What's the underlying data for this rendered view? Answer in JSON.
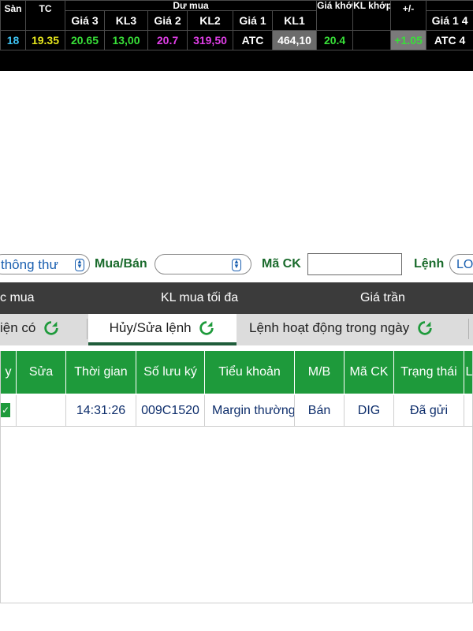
{
  "board": {
    "headers": {
      "san": "Sàn",
      "tc": "TC",
      "du_mua": "Dư mua",
      "gia_khop": "Giá khớp",
      "kl_khop": "KL khớp",
      "change": "+/-",
      "gia3": "Giá 3",
      "kl3": "KL3",
      "gia2": "Giá 2",
      "kl2": "KL2",
      "gia1": "Giá 1",
      "kl1": "KL1",
      "gia1_sell": "Giá 1"
    },
    "row": {
      "san": "18",
      "tc": "19.35",
      "gia3": "20.65",
      "kl3": "13,00",
      "gia2": "20.7",
      "kl2": "319,50",
      "gia1": "ATC",
      "kl1": "464,10",
      "gia_khop": "20.4",
      "kl_khop": "",
      "change": "+1.05",
      "gia1_sell": "ATC",
      "tail": "4"
    }
  },
  "filters": {
    "left_select_value": "thông thư",
    "mua_ban_label": "Mua/Bán",
    "mua_ban_value": "",
    "ma_ck_label": "Mã CK",
    "ma_ck_value": "",
    "lenh_label": "Lệnh",
    "lenh_value": "LO"
  },
  "info_bar": {
    "col1": "c mua",
    "col2": "KL mua tối đa",
    "col3": "Giá trần"
  },
  "tabs": [
    {
      "label": "iện có"
    },
    {
      "label": "Hủy/Sửa lệnh"
    },
    {
      "label": "Lệnh hoạt động trong ngày"
    }
  ],
  "orders": {
    "columns": [
      "y",
      "Sửa",
      "Thời gian",
      "Số lưu ký",
      "Tiểu khoản",
      "M/B",
      "Mã CK",
      "Trạng thái",
      "L"
    ],
    "rows": [
      {
        "time": "14:31:26",
        "depository": "009C1520",
        "sub_account": "Margin thường",
        "side": "Bán",
        "symbol": "DIG",
        "status": "Đã gửi"
      }
    ]
  },
  "colors": {
    "header_green": "#1e9a3b",
    "dark_bar": "#3b3b3b",
    "text_navy": "#0d2d6b"
  }
}
